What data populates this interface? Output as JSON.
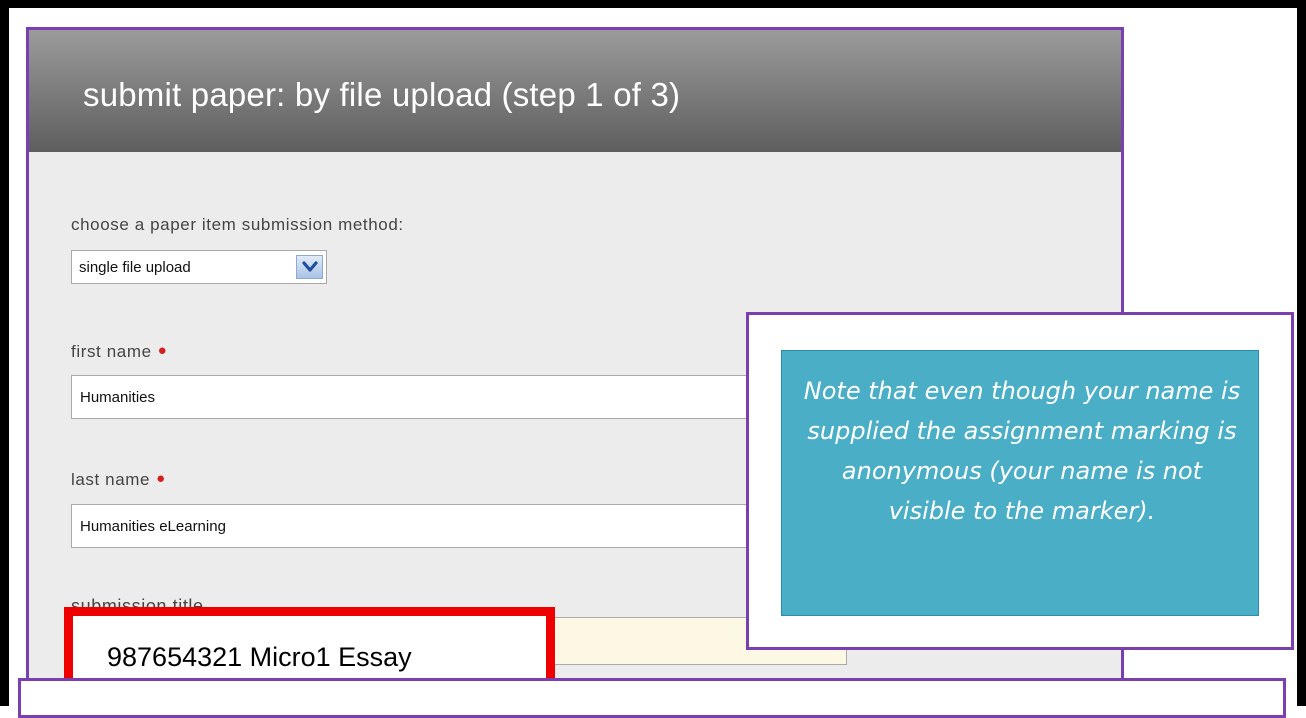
{
  "header": {
    "title": "submit paper: by file upload (step 1 of 3)"
  },
  "method": {
    "label": "choose a paper item submission method:",
    "selected": "single file upload"
  },
  "first_name": {
    "label": "first name",
    "value": "Humanities"
  },
  "last_name": {
    "label": "last name",
    "value": "Humanities eLearning"
  },
  "submission_title": {
    "label": "submission title",
    "value": "987654321 Micro1 Essay"
  },
  "note": {
    "text": "Note that even though your name is supplied the assignment marking is anonymous (your name is not visible to the marker)."
  },
  "colors": {
    "accent_border": "#7a3fb0",
    "highlight": "#ee0000",
    "note_bg": "#4aaec7",
    "required": "#d21f1f"
  },
  "icons": {
    "dropdown": "chevron-down-icon",
    "required": "required-dot-icon"
  }
}
